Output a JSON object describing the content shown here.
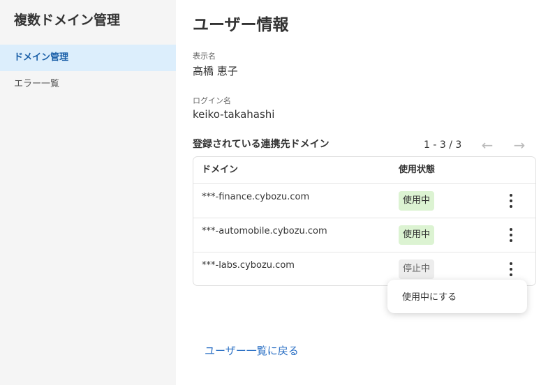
{
  "sidebar": {
    "title": "複数ドメイン管理",
    "items": [
      {
        "label": "ドメイン管理",
        "active": true
      },
      {
        "label": "エラー一覧",
        "active": false
      }
    ]
  },
  "main": {
    "title": "ユーザー情報",
    "display_name": {
      "label": "表示名",
      "value": "高橋 恵子"
    },
    "login_name": {
      "label": "ログイン名",
      "value": "keiko-takahashi"
    },
    "section_title": "登録されている連携先ドメイン",
    "pager": {
      "count": "1 - 3 / 3",
      "prev_icon": "arrow-left-icon",
      "next_icon": "arrow-right-icon"
    },
    "table": {
      "headers": [
        "ドメイン",
        "使用状態"
      ],
      "rows": [
        {
          "domain": "***-finance.cybozu.com",
          "status": "使用中",
          "status_type": "on"
        },
        {
          "domain": "***-automobile.cybozu.com",
          "status": "使用中",
          "status_type": "on"
        },
        {
          "domain": "***-labs.cybozu.com",
          "status": "停止中",
          "status_type": "off"
        }
      ]
    },
    "context_menu": {
      "item": "使用中にする"
    },
    "back_link": "ユーザー一覧に戻る"
  },
  "colors": {
    "accent": "#1a5fa8",
    "link": "#2a6fc4",
    "active_nav_bg": "#dceefc",
    "badge_on_bg": "#dcf3d2",
    "badge_off_bg": "#ededed"
  }
}
